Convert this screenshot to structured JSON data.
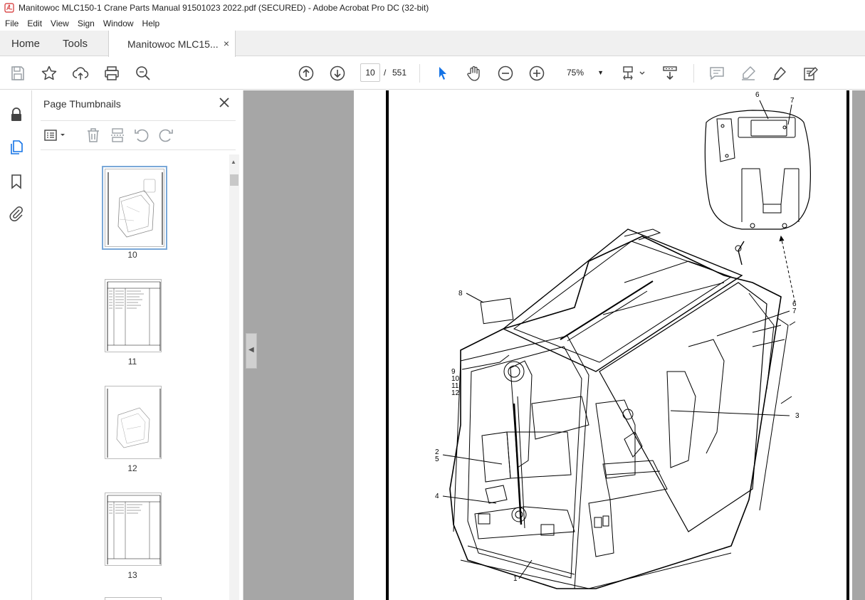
{
  "window": {
    "title": "Manitowoc MLC150-1 Crane Parts Manual 91501023 2022.pdf (SECURED) - Adobe Acrobat Pro DC (32-bit)"
  },
  "menu": [
    "File",
    "Edit",
    "View",
    "Sign",
    "Window",
    "Help"
  ],
  "tabs": {
    "home": "Home",
    "tools": "Tools",
    "document": "Manitowoc MLC15...",
    "close_glyph": "×"
  },
  "toolbar": {
    "current_page": "10",
    "page_separator": "/",
    "total_pages": "551",
    "zoom": "75%",
    "icons": [
      "save-icon",
      "bookmark-star-icon",
      "share-upload-icon",
      "print-icon",
      "search-zoom-icon",
      "page-up-icon",
      "page-down-icon",
      "select-arrow-icon",
      "hand-icon",
      "zoom-out-icon",
      "zoom-in-icon",
      "page-view-icon",
      "scroll-mode-icon",
      "comment-icon",
      "highlight-icon",
      "sign-icon",
      "fill-sign-icon"
    ]
  },
  "left_rail": {
    "icons": [
      "lock-icon",
      "pages-icon",
      "bookmark-icon",
      "attachment-icon"
    ]
  },
  "thumbnails_panel": {
    "title": "Page Thumbnails",
    "pages": [
      {
        "label": "10",
        "kind": "drawing",
        "selected": true
      },
      {
        "label": "11",
        "kind": "table",
        "selected": false
      },
      {
        "label": "12",
        "kind": "drawing",
        "selected": false
      },
      {
        "label": "13",
        "kind": "table",
        "selected": false
      }
    ]
  },
  "document": {
    "callouts": {
      "c6_top": "6",
      "c7_top": "7",
      "c8": "8",
      "c6_side": "6",
      "c7_side": "7",
      "c9": "9",
      "c10": "10",
      "c11": "11",
      "c12": "12",
      "c3": "3",
      "c2": "2",
      "c5": "5",
      "c4": "4",
      "c1": "1"
    }
  }
}
